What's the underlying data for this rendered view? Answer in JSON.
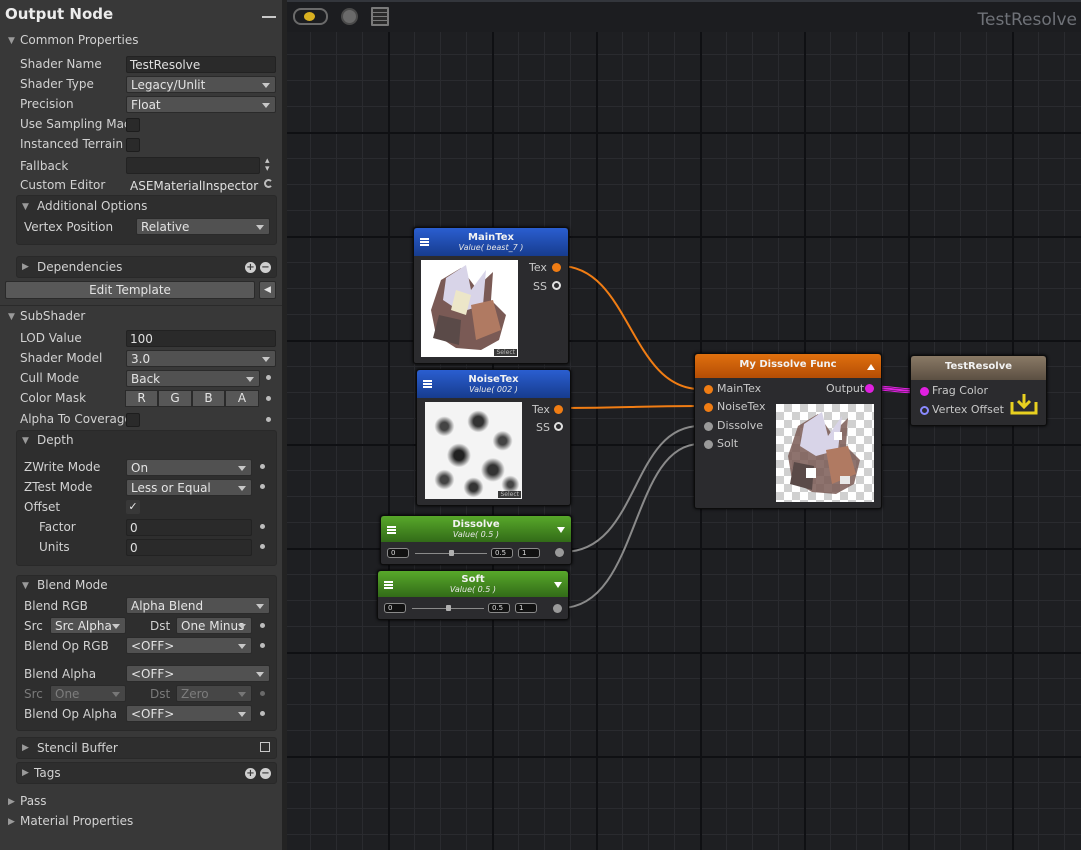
{
  "panel": {
    "title": "Output Node",
    "common": {
      "header": "Common Properties",
      "shader_name_label": "Shader Name",
      "shader_name": "TestResolve",
      "shader_type_label": "Shader Type",
      "shader_type": "Legacy/Unlit",
      "precision_label": "Precision",
      "precision": "Float",
      "sampling_label": "Use Sampling Mac",
      "terrain_label": "Instanced Terrain",
      "fallback_label": "Fallback",
      "fallback": "",
      "custom_editor_label": "Custom Editor",
      "custom_editor": "ASEMaterialInspector",
      "additional_header": "Additional Options",
      "vertex_position_label": "Vertex Position",
      "vertex_position": "Relative",
      "dependencies_label": "Dependencies",
      "edit_template": "Edit Template"
    },
    "subshader": {
      "header": "SubShader",
      "lod_label": "LOD Value",
      "lod": "100",
      "model_label": "Shader Model",
      "model": "3.0",
      "cull_label": "Cull Mode",
      "cull": "Back",
      "mask_label": "Color Mask",
      "mask": [
        "R",
        "G",
        "B",
        "A"
      ],
      "alpha_cov_label": "Alpha To Coverage"
    },
    "depth": {
      "header": "Depth",
      "zwrite_label": "ZWrite Mode",
      "zwrite": "On",
      "ztest_label": "ZTest Mode",
      "ztest": "Less or Equal",
      "offset_label": "Offset",
      "offset_checked": "✓",
      "factor_label": "Factor",
      "factor": "0",
      "units_label": "Units",
      "units": "0"
    },
    "blend": {
      "header": "Blend Mode",
      "rgb_label": "Blend RGB",
      "rgb": "Alpha Blend",
      "src_label": "Src",
      "src": "Src Alpha",
      "dst_label": "Dst",
      "dst": "One Minus",
      "oprgb_label": "Blend Op RGB",
      "oprgb": "<OFF>",
      "alpha_label": "Blend Alpha",
      "alpha": "<OFF>",
      "src2_label": "Src",
      "src2": "One",
      "dst2_label": "Dst",
      "dst2": "Zero",
      "opalpha_label": "Blend Op Alpha",
      "opalpha": "<OFF>"
    },
    "stencil_label": "Stencil Buffer",
    "tags_label": "Tags",
    "pass_label": "Pass",
    "material_label": "Material Properties"
  },
  "canvas": {
    "graph_title": "TestResolve",
    "nodes": {
      "maintex": {
        "title": "MainTex",
        "subtitle": "Value( beast_7 )",
        "out_tex": "Tex",
        "out_ss": "SS",
        "select": "Select"
      },
      "noisetex": {
        "title": "NoiseTex",
        "subtitle": "Value( 002 )",
        "out_tex": "Tex",
        "out_ss": "SS",
        "select": "Select"
      },
      "dissolve": {
        "title": "Dissolve",
        "subtitle": "Value( 0.5 )",
        "min": "0",
        "value": "0.5",
        "max": "1",
        "level": 0.5
      },
      "soft": {
        "title": "Soft",
        "subtitle": "Value( 0.5 )",
        "min": "0",
        "value": "0.5",
        "max": "1",
        "level": 0.5
      },
      "func": {
        "title": "My Dissolve Func",
        "in1": "MainTex",
        "in2": "NoiseTex",
        "in3": "Dissolve",
        "in4": "Solt",
        "out": "Output"
      },
      "output": {
        "title": "TestResolve",
        "in1": "Frag Color",
        "in2": "Vertex Offset"
      }
    }
  },
  "colors": {
    "wire_tex": "#f07d14",
    "wire_float": "#8a8a8a",
    "wire_color": "#e020e0"
  }
}
